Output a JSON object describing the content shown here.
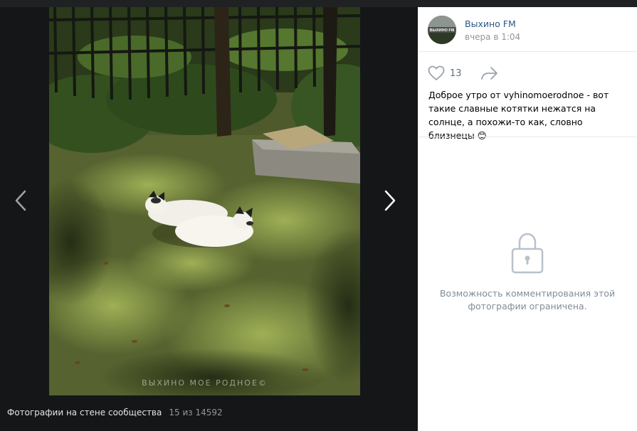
{
  "viewer": {
    "photo_watermark": "ВЫХИНО МОЕ РОДНОЕ©",
    "album_caption": "Фотографии на стене сообщества",
    "photo_counter": "15 из 14592"
  },
  "post": {
    "author_name": "Выхино FM",
    "avatar_text": "ВЫХИНО FM",
    "time": "вчера в 1:04",
    "like_count": "13",
    "text": "Доброе утро от vyhinomoerodnoe - вот такие славные котятки нежатся на солнце, а похожи-то как, словно близнецы 😊"
  },
  "comments": {
    "restricted_text": "Возможность комментирования этой фотографии ограничена."
  },
  "colors": {
    "accent_link": "#2a5885",
    "muted_text": "#939699",
    "viewer_bg": "#151618",
    "lock_icon": "#b8c1cc"
  },
  "icons": [
    "chevron-left-icon",
    "chevron-right-icon",
    "heart-icon",
    "share-arrow-icon",
    "lock-icon"
  ]
}
